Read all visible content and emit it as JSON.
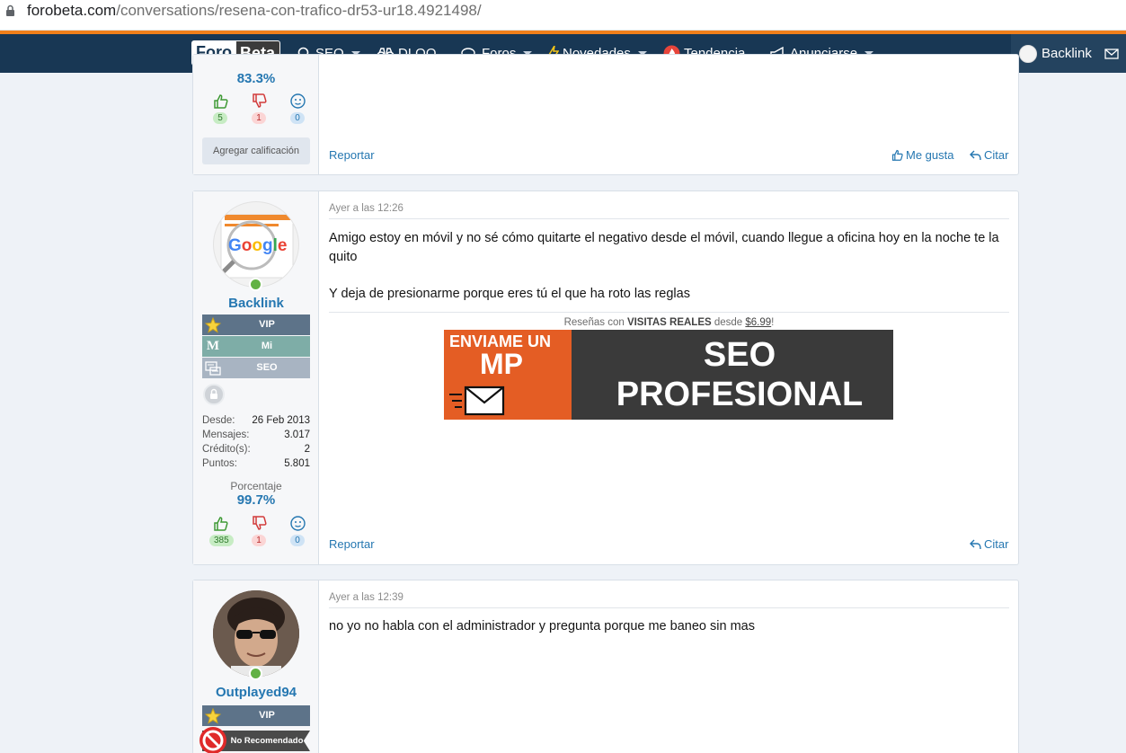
{
  "browser": {
    "url_domain": "forobeta.com",
    "url_path": "/conversations/resena-con-trafico-dr53-ur18.4921498/"
  },
  "nav": {
    "logo_part1": "Foro",
    "logo_part2": "Beta",
    "items": [
      {
        "label": "SEO",
        "icon": "search-icon",
        "caret": true
      },
      {
        "label": "DLQQ",
        "icon": "binoculars-icon",
        "caret": false
      },
      {
        "label": "Foros",
        "icon": "chat-icon",
        "caret": true
      },
      {
        "label": "Novedades",
        "icon": "bolt-icon",
        "caret": true
      },
      {
        "label": "Tendencia",
        "icon": "fire-icon",
        "caret": false
      },
      {
        "label": "Anunciarse",
        "icon": "megaphone-icon",
        "caret": true
      }
    ],
    "user_label": "Backlink",
    "colors": {
      "bar": "#183754",
      "accent": "#f07f1b"
    }
  },
  "post1": {
    "percentage": "83.3%",
    "votes": {
      "up": "5",
      "down": "1",
      "neutral": "0"
    },
    "rate_button": "Agregar calificación",
    "report": "Reportar",
    "like": "Me gusta",
    "quote": "Citar"
  },
  "post2": {
    "username": "Backlink",
    "banners": [
      {
        "label": "VIP",
        "icon": "star-icon"
      },
      {
        "label": "Mi",
        "icon": "m-icon"
      },
      {
        "label": "SEO",
        "icon": "seo-icon"
      }
    ],
    "stats": {
      "since_label": "Desde:",
      "since": "26 Feb 2013",
      "messages_label": "Mensajes:",
      "messages": "3.017",
      "credits_label": "Crédito(s):",
      "credits": "2",
      "points_label": "Puntos:",
      "points": "5.801"
    },
    "percentage_label": "Porcentaje",
    "percentage": "99.7%",
    "votes": {
      "up": "385",
      "down": "1",
      "neutral": "0"
    },
    "date": "Ayer a las 12:26",
    "message_line1": "Amigo estoy en móvil y no sé cómo quitarte el negativo desde el móvil, cuando llegue a oficina hoy en la noche te la quito",
    "message_line2": "Y deja de presionarme porque eres tú el que ha roto las reglas",
    "signature_text_pre": "Reseñas con ",
    "signature_text_bold": "VISITAS REALES",
    "signature_text_mid": " desde ",
    "signature_text_price": "$6.99",
    "signature_text_end": "!",
    "ad": {
      "left_line1": "ENVIAME UN",
      "left_line2": "MP",
      "right_line1": "SEO",
      "right_line2": "PROFESIONAL"
    },
    "report": "Reportar",
    "quote": "Citar"
  },
  "post3": {
    "username": "Outplayed94",
    "banners": [
      {
        "label": "VIP",
        "icon": "star-icon"
      },
      {
        "label": "No Recomendado",
        "icon": "no-entry-icon"
      }
    ],
    "date": "Ayer a las 12:39",
    "message": "no yo no habla con el administrador y pregunta porque me baneo sin mas"
  }
}
